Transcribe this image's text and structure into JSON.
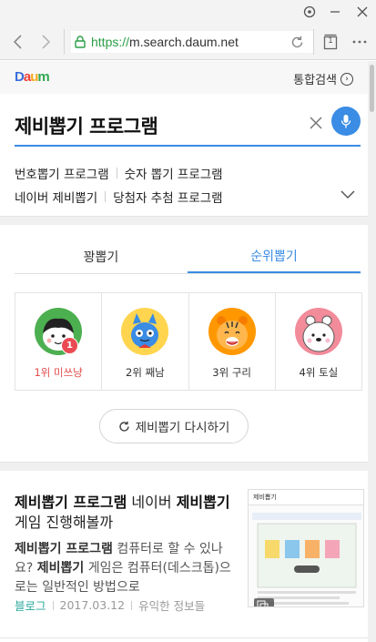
{
  "browser": {
    "url_protocol": "https://",
    "url_host": "m.search.daum.net",
    "tab_count": "1"
  },
  "header": {
    "logo": "Daum",
    "tonghap_label": "통합검색"
  },
  "search": {
    "query": "제비뽑기 프로그램"
  },
  "related": {
    "row1": [
      "번호뽑기 프로그램",
      "숫자 뽑기 프로그램"
    ],
    "row2": [
      "네이버 제비뽑기",
      "당첨자 추첨 프로그램"
    ]
  },
  "tabs": [
    {
      "label": "꽝뽑기",
      "active": false
    },
    {
      "label": "순위뽑기",
      "active": true
    }
  ],
  "ranks": [
    {
      "label": "1위 미쓰냥",
      "badge": "1",
      "bg": "#4caf50"
    },
    {
      "label": "2위 째남",
      "bg": "#ffd54f"
    },
    {
      "label": "3위 구리",
      "bg": "#ff9800"
    },
    {
      "label": "4위 토실",
      "bg": "#f28b9a"
    }
  ],
  "replay_label": "제비뽑기 다시하기",
  "result": {
    "title_bold1": "제비뽑기 프로그램",
    "title_normal1": " 네이버 ",
    "title_bold2": "제비뽑기",
    "title_normal2": " 게임 진행해볼까",
    "desc_bold1": "제비뽑기 프로그램",
    "desc_normal1": " 컴퓨터로 할 수 있나요? ",
    "desc_bold2": "제비뽑기",
    "desc_normal2": " 게임은 컴퓨터(데스크톱)으로는 일반적인 방법으로",
    "source": "블로그",
    "date": "2017.03.12",
    "blog_name": "유익한 정보들",
    "thumb_title": "제비뽑기"
  }
}
